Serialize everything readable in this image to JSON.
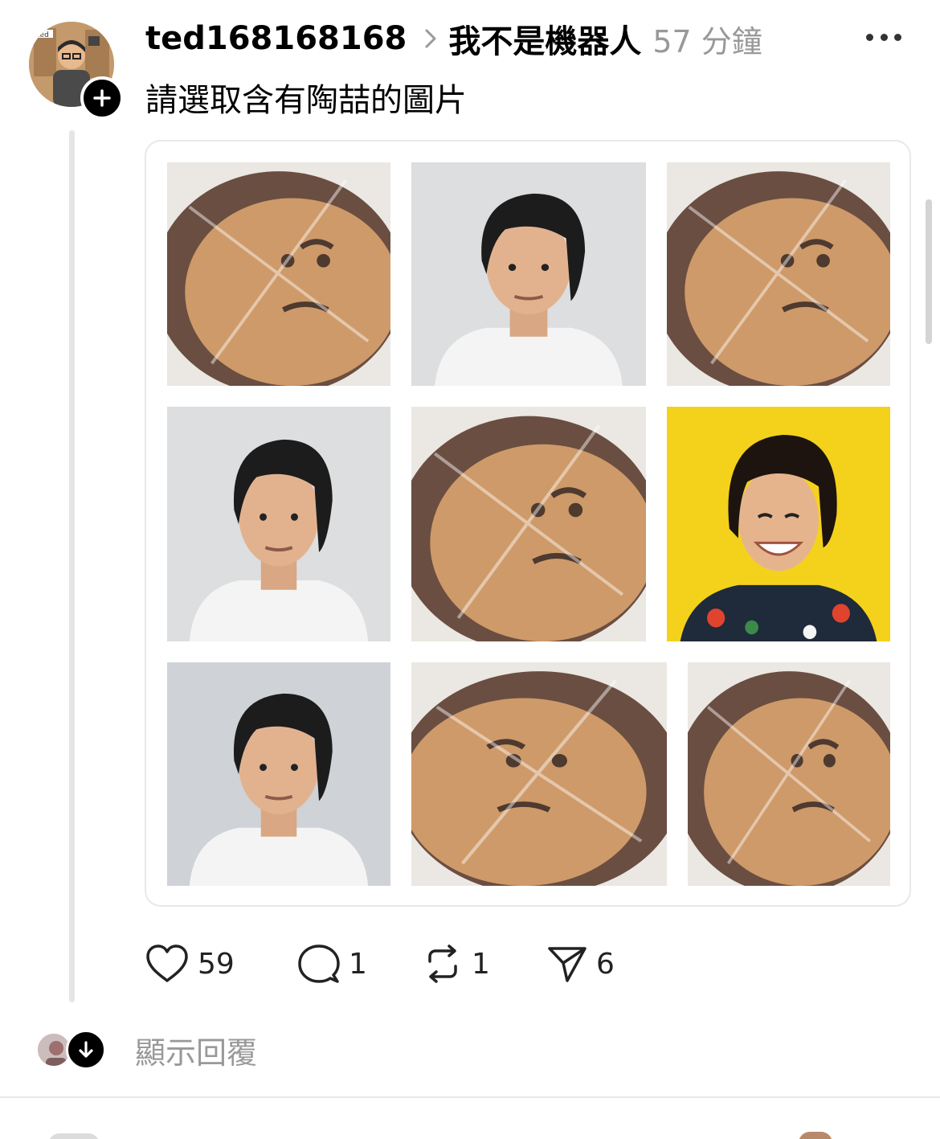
{
  "post": {
    "username": "ted168168168",
    "tag": "我不是機器人",
    "time": "57 分鐘",
    "text": "請選取含有陶喆的圖片",
    "avatar_label": "ted"
  },
  "grid": {
    "tiles": [
      {
        "kind": "cookie"
      },
      {
        "kind": "person"
      },
      {
        "kind": "cookie"
      },
      {
        "kind": "person"
      },
      {
        "kind": "cookie"
      },
      {
        "kind": "person-smiling"
      },
      {
        "kind": "person"
      },
      {
        "kind": "cookie"
      },
      {
        "kind": "cookie"
      }
    ]
  },
  "actions": {
    "likes": "59",
    "comments": "1",
    "reposts": "1",
    "shares": "6"
  },
  "replies": {
    "label": "顯示回覆"
  },
  "icons": {
    "like": "heart-icon",
    "comment": "comment-icon",
    "repost": "repost-icon",
    "share": "send-icon",
    "more": "more-icon",
    "follow": "plus-icon",
    "expand": "arrow-down-icon"
  }
}
